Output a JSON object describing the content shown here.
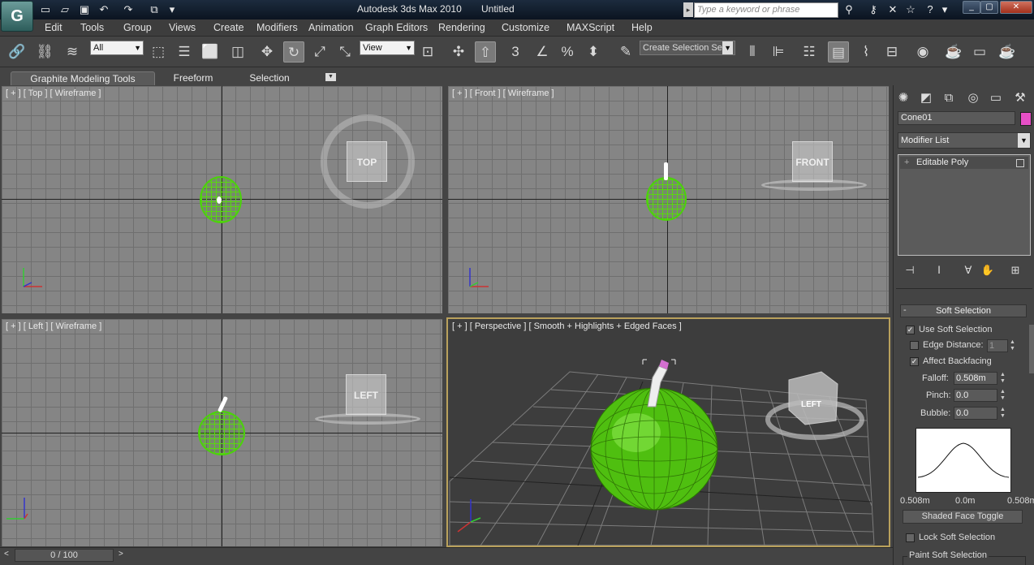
{
  "window": {
    "app_title": "Autodesk 3ds Max  2010",
    "doc_title": "Untitled",
    "logo": "G",
    "search_placeholder": "Type a keyword or phrase"
  },
  "quick_access": [
    "new-icon",
    "open-icon",
    "save-icon",
    "undo-icon",
    "redo-icon",
    "project-icon"
  ],
  "menu": [
    "Edit",
    "Tools",
    "Group",
    "Views",
    "Create",
    "Modifiers",
    "Animation",
    "Graph Editors",
    "Rendering",
    "Customize",
    "MAXScript",
    "Help"
  ],
  "toolbar": {
    "selection_filter": "All",
    "ref_coord": "View",
    "named_selection": "Create Selection Se"
  },
  "ribbon": {
    "tabs": [
      "Graphite Modeling Tools",
      "Freeform",
      "Selection"
    ]
  },
  "viewports": {
    "top": {
      "label": "[ + ] [ Top ] [ Wireframe ]",
      "cube": "TOP"
    },
    "front": {
      "label": "[ + ] [ Front ] [ Wireframe ]",
      "cube": "FRONT"
    },
    "left": {
      "label": "[ + ] [ Left ] [ Wireframe ]",
      "cube": "LEFT"
    },
    "perspective": {
      "label": "[ + ] [ Perspective ] [ Smooth + Highlights + Edged Faces ]",
      "cube": "LEFT"
    }
  },
  "command_panel": {
    "object_name": "Cone01",
    "object_color": "#e64fc6",
    "modifier_list": "Modifier List",
    "stack_items": [
      "Editable Poly"
    ],
    "soft_selection": {
      "title": "Soft Selection",
      "use_soft_selection": "Use Soft Selection",
      "edge_distance": "Edge Distance:",
      "edge_distance_value": "1",
      "affect_backfacing": "Affect Backfacing",
      "falloff_label": "Falloff:",
      "falloff_value": "0.508m",
      "pinch_label": "Pinch:",
      "pinch_value": "0.0",
      "bubble_label": "Bubble:",
      "bubble_value": "0.0",
      "curve_left": "0.508m",
      "curve_mid": "0.0m",
      "curve_right": "0.508m",
      "shaded_face_toggle": "Shaded Face Toggle",
      "lock_soft_selection": "Lock Soft Selection",
      "paint_soft_selection": "Paint Soft Selection"
    }
  },
  "time_slider": {
    "value": "0 / 100"
  },
  "colors": {
    "selection_green": "#4bd20b",
    "active_viewport_border": "#b9a15c"
  }
}
